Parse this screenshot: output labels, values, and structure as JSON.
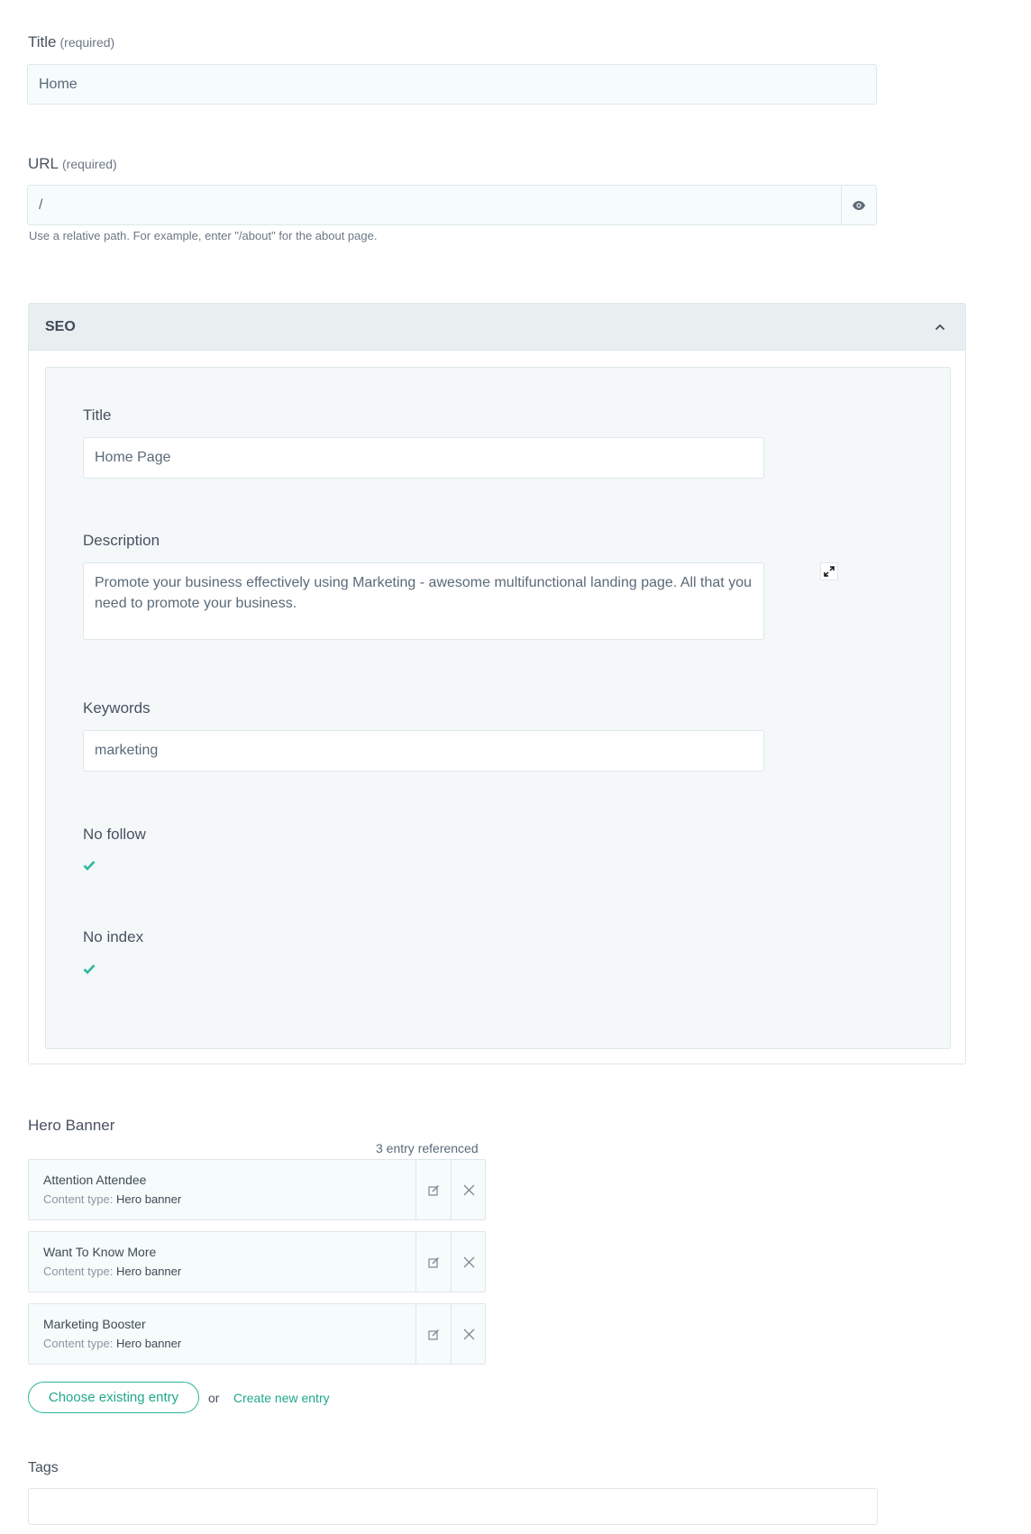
{
  "title_field": {
    "label": "Title",
    "required": "(required)",
    "value": "Home"
  },
  "url_field": {
    "label": "URL",
    "required": "(required)",
    "value": "/",
    "help": "Use a relative path. For example, enter \"/about\" for the about page.",
    "preview_icon": "eye-icon"
  },
  "seo": {
    "header": "SEO",
    "collapse_icon": "chevron-up-icon",
    "title": {
      "label": "Title",
      "value": "Home Page"
    },
    "description": {
      "label": "Description",
      "value": "Promote your business effectively using Marketing - awesome multifunctional landing page. All that you need to promote your business.",
      "expand_icon": "expand-icon"
    },
    "keywords": {
      "label": "Keywords",
      "value": "marketing"
    },
    "no_follow": {
      "label": "No follow",
      "checked": true
    },
    "no_index": {
      "label": "No index",
      "checked": true
    }
  },
  "hero_banner": {
    "label": "Hero Banner",
    "count": "3 entry referenced",
    "entries": [
      {
        "title": "Attention Attendee",
        "type_label": "Content type:",
        "type_value": "Hero banner"
      },
      {
        "title": "Want To Know More",
        "type_label": "Content type:",
        "type_value": "Hero banner"
      },
      {
        "title": "Marketing Booster",
        "type_label": "Content type:",
        "type_value": "Hero banner"
      }
    ],
    "choose_button": "Choose existing entry",
    "or_text": "or",
    "create_link": "Create new entry"
  },
  "tags": {
    "label": "Tags",
    "value": ""
  },
  "colors": {
    "accent": "#1fa88b",
    "check": "#2db79a",
    "field_bg": "#f6fbfb",
    "panel_header_bg": "#e9eef1"
  }
}
